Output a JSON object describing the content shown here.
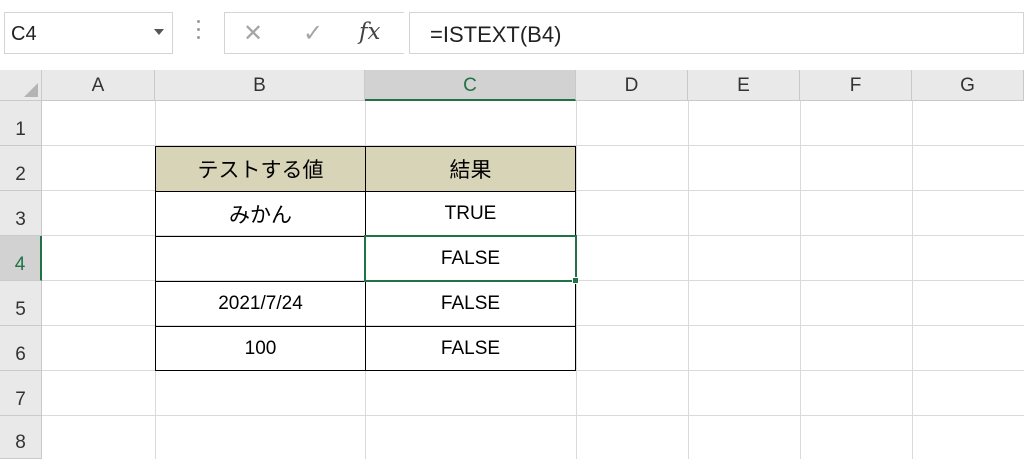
{
  "name_box": {
    "value": "C4"
  },
  "formula_bar": {
    "cancel_icon": "close-icon",
    "enter_icon": "check-icon",
    "fx_label": "fx",
    "formula": "=ISTEXT(B4)"
  },
  "columns": [
    "A",
    "B",
    "C",
    "D",
    "E",
    "F",
    "G"
  ],
  "rows": [
    "1",
    "2",
    "3",
    "4",
    "5",
    "6",
    "7",
    "8"
  ],
  "selected": {
    "column": "C",
    "row": "4"
  },
  "table": {
    "headers": [
      "テストする値",
      "結果"
    ],
    "rows": [
      {
        "value": "みかん",
        "result": "TRUE"
      },
      {
        "value": "",
        "result": "FALSE"
      },
      {
        "value": "2021/7/24",
        "result": "FALSE"
      },
      {
        "value": "100",
        "result": "FALSE"
      }
    ]
  },
  "colors": {
    "accent": "#217346",
    "header_fill": "#d8d4b8",
    "grid_line": "#dadada",
    "header_bg": "#e9e9e9"
  }
}
